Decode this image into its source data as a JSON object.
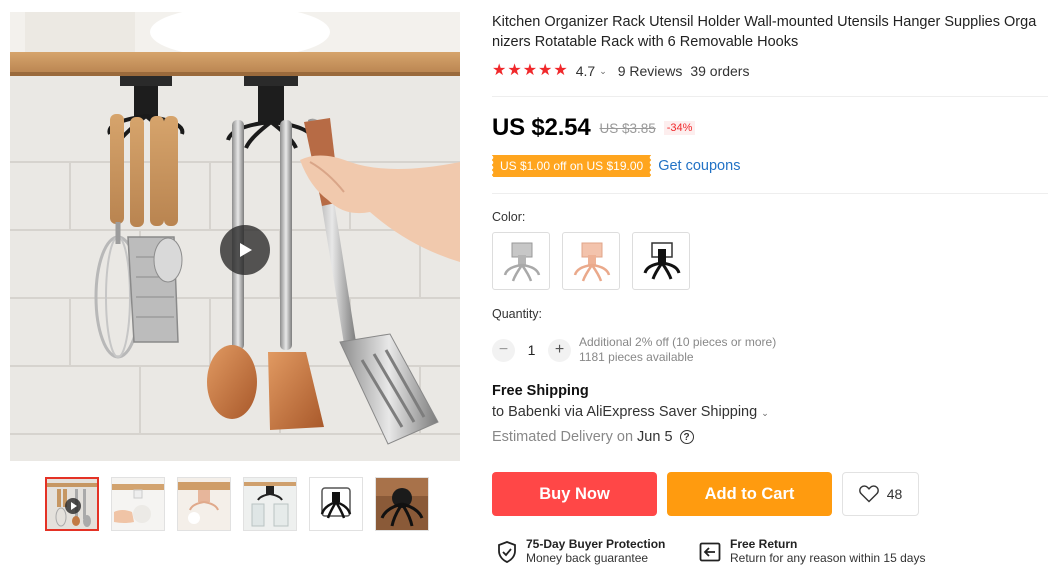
{
  "product": {
    "title": "Kitchen Organizer Rack Utensil Holder Wall-mounted Utensils Hanger Supplies Organizers Rotatable Rack with 6 Removable Hooks",
    "rating": "4.7",
    "reviews": "9 Reviews",
    "orders": "39 orders"
  },
  "price": {
    "current": "US $2.54",
    "original": "US $3.85",
    "discount": "-34%",
    "coupon": "US $1.00 off on US $19.00",
    "get_coupons": "Get coupons"
  },
  "color": {
    "label": "Color:",
    "options": [
      "silver",
      "rose-gold",
      "black"
    ]
  },
  "quantity": {
    "label": "Quantity:",
    "value": "1",
    "decrement": "−",
    "increment": "+",
    "note": "Additional 2% off (10 pieces or more)",
    "available": "1181 pieces available"
  },
  "shipping": {
    "title": "Free Shipping",
    "to": "to Babenki via AliExpress Saver Shipping",
    "delivery_prefix": "Estimated Delivery on",
    "delivery_date": "Jun 5",
    "help": "?"
  },
  "actions": {
    "buy_now": "Buy Now",
    "add_to_cart": "Add to Cart",
    "wishlist_count": "48"
  },
  "guarantees": [
    {
      "title": "75-Day Buyer Protection",
      "subtitle": "Money back guarantee",
      "icon": "shield-check-icon"
    },
    {
      "title": "Free Return",
      "subtitle": "Return for any reason within 15 days",
      "icon": "return-icon"
    }
  ],
  "gallery": {
    "thumbnail_count": 6,
    "active_index": 0
  },
  "colors": {
    "accent_red": "#ff4747",
    "accent_orange": "#ff9b0f",
    "star": "#f0282b",
    "link": "#2272c5"
  }
}
